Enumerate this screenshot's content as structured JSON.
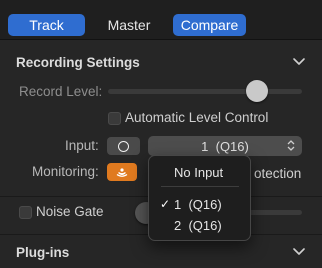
{
  "tabs": {
    "track": "Track",
    "master": "Master",
    "compare": "Compare"
  },
  "recording_settings": {
    "title": "Recording Settings",
    "record_level_label": "Record Level:",
    "record_level_value": 0.77,
    "auto_level_control_label": "Automatic Level Control",
    "input_label": "Input:",
    "input_value": "1  (Q16)",
    "monitoring_label": "Monitoring:",
    "behind_menu_text": "otection"
  },
  "noise_gate": {
    "label": "Noise Gate"
  },
  "plugins": {
    "title": "Plug-ins"
  },
  "input_menu": {
    "items": [
      "No Input",
      "1  (Q16)",
      "2  (Q16)"
    ],
    "selected_index": 1
  },
  "colors": {
    "accent": "#2f6dd0",
    "monitoring": "#e07a1f"
  }
}
